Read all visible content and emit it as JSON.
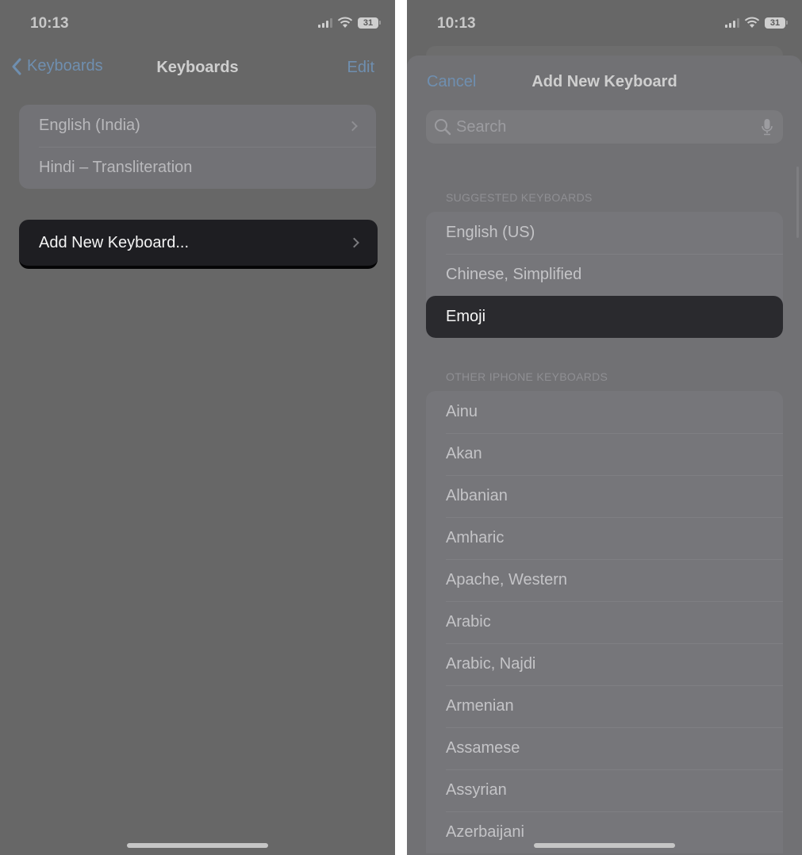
{
  "left_screen": {
    "status": {
      "time": "10:13",
      "battery": "31"
    },
    "nav": {
      "back_label": "Keyboards",
      "title": "Keyboards",
      "edit_label": "Edit"
    },
    "keyboards": [
      {
        "label": "English (India)",
        "has_chevron": true
      },
      {
        "label": "Hindi – Transliteration",
        "has_chevron": false
      }
    ],
    "add_new_keyboard": {
      "label": "Add New Keyboard..."
    }
  },
  "right_screen": {
    "status": {
      "time": "10:13",
      "battery": "31"
    },
    "sheet": {
      "cancel_label": "Cancel",
      "title": "Add New Keyboard"
    },
    "search": {
      "placeholder": "Search",
      "value": ""
    },
    "suggested": {
      "header": "Suggested Keyboards",
      "items": [
        "English (US)",
        "Chinese, Simplified",
        "Emoji"
      ],
      "selected": "Emoji"
    },
    "other": {
      "header": "Other iPhone Keyboards",
      "items": [
        "Ainu",
        "Akan",
        "Albanian",
        "Amharic",
        "Apache, Western",
        "Arabic",
        "Arabic, Najdi",
        "Armenian",
        "Assamese",
        "Assyrian",
        "Azerbaijani"
      ]
    }
  },
  "colors": {
    "accent": "#6f8fb0",
    "background": "#676767",
    "highlight": "#1e1e22"
  }
}
